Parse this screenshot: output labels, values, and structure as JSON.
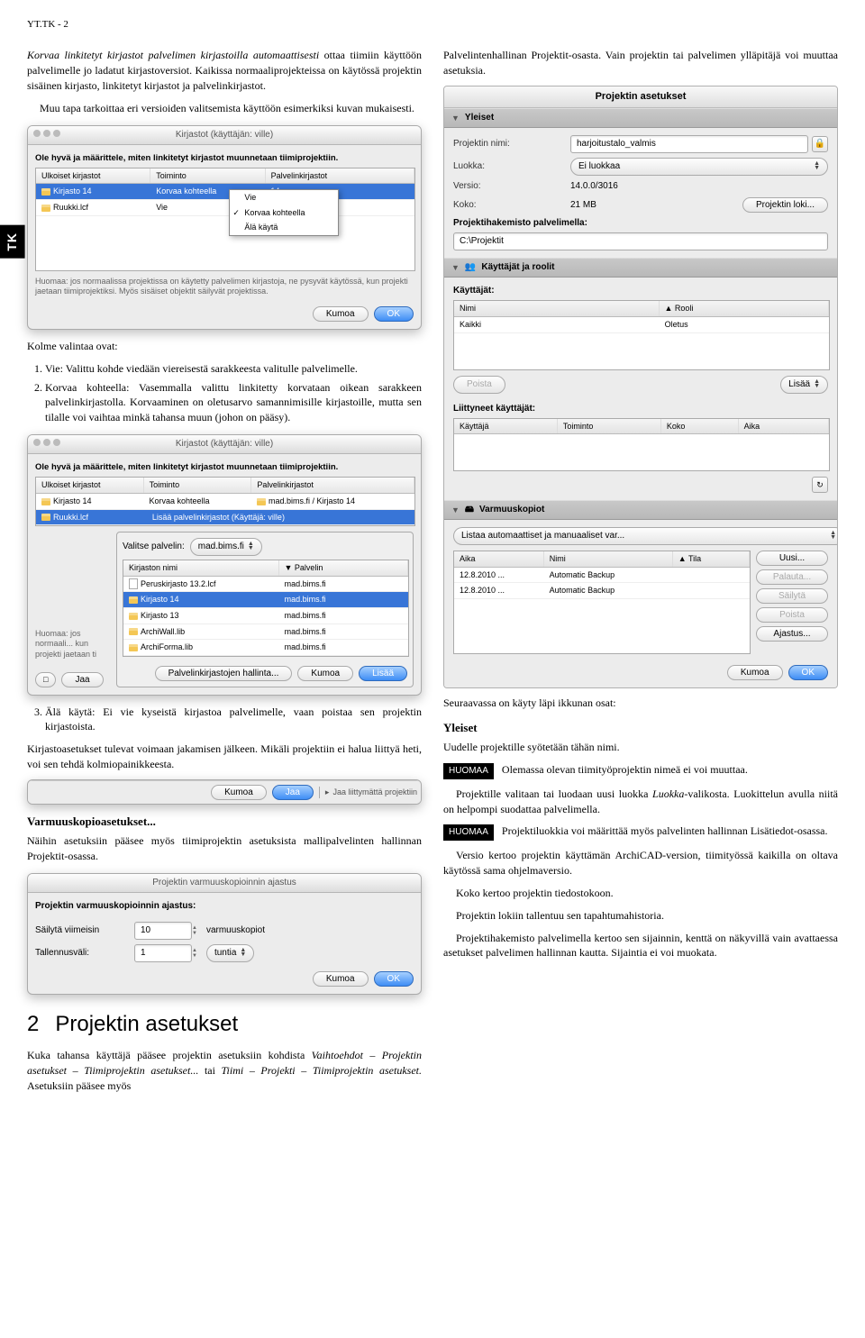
{
  "page_header": "YT.TK - 2",
  "side_tab": "TK",
  "left": {
    "intro_p1_italic": "Korvaa linkitetyt kirjastot palvelimen kirjastoilla automaattisesti",
    "intro_p1_rest": " ottaa tiimiin käyttöön palvelimelle jo ladatut kirjastoversiot. Kaikissa normaaliprojekteissa on käytössä projektin sisäinen kirjasto, linkitetyt kirjastot ja palvelinkirjastot.",
    "intro_p2": "Muu tapa tarkoittaa eri versioiden valitsemista käyttöön esimerkiksi kuvan mukaisesti.",
    "dlg1": {
      "title": "Kirjastot (käyttäjän: ville)",
      "instr": "Ole hyvä ja määrittele, miten linkitetyt kirjastot muunnetaan tiimiprojektiin.",
      "th1": "Ulkoiset kirjastot",
      "th2": "Toiminto",
      "th3": "Palvelinkirjastot",
      "row1_c1": "Kirjasto 14",
      "row1_c2": "Korvaa kohteella",
      "row1_c3": "14",
      "row2_c1": "Ruukki.lcf",
      "row2_c2": "Vie",
      "row2_c3": "cf",
      "dd1": "Vie",
      "dd2": "Korvaa kohteella",
      "dd3": "Älä käytä",
      "note": "Huomaa: jos normaalissa projektissa on käytetty palvelimen kirjastoja, ne pysyvät käytössä, kun projekti jaetaan tiimiprojektiksi. Myös sisäiset objektit säilyvät projektissa.",
      "btn_cancel": "Kumoa",
      "btn_ok": "OK"
    },
    "three_options": "Kolme valintaa ovat:",
    "opt1": "Vie: Valittu kohde viedään viereisestä sarakkeesta valitulle palvelimelle.",
    "opt2": "Korvaa kohteella: Vasemmalla valittu linkitetty korvataan oikean sarakkeen palvelinkirjastolla. Korvaaminen on oletusarvo samannimisille kirjastoille, mutta sen tilalle voi vaihtaa minkä tahansa muun (johon on pääsy).",
    "dlg2": {
      "title": "Kirjastot (käyttäjän: ville)",
      "instr": "Ole hyvä ja määrittele, miten linkitetyt kirjastot muunnetaan tiimiprojektiin.",
      "th1": "Ulkoiset kirjastot",
      "th2": "Toiminto",
      "th3": "Palvelinkirjastot",
      "r1c1": "Kirjasto 14",
      "r1c2": "Korvaa kohteella",
      "r1c3": "mad.bims.fi / Kirjasto 14",
      "r2c1": "Ruukki.lcf",
      "r2c2": "Lisää palvelinkirjastot (Käyttäjä: ville)",
      "select_server": "Valitse palvelin:",
      "server": "mad.bims.fi",
      "sth1": "Kirjaston nimi",
      "sth2": "Palvelin",
      "sr1": "Peruskirjasto 13.2.lcf",
      "sr1s": "mad.bims.fi",
      "sr2": "Kirjasto 14",
      "sr2s": "mad.bims.fi",
      "sr3": "Kirjasto 13",
      "sr3s": "mad.bims.fi",
      "sr4": "ArchiWall.lib",
      "sr4s": "mad.bims.fi",
      "sr5": "ArchiForma.lib",
      "sr5s": "mad.bims.fi",
      "note": "Huomaa: jos normaali... kun projekti jaetaan ti",
      "btn_jaa": "Jaa",
      "btn_manage": "Palvelinkirjastojen hallinta...",
      "btn_cancel": "Kumoa",
      "btn_add": "Lisää"
    },
    "opt3": "Älä käytä: Ei vie kyseistä kirjastoa palvelimelle, vaan poistaa sen projektin kirjastoista.",
    "after_opts": "Kirjastoasetukset tulevat voimaan jakamisen jälkeen. Mikäli projektiin ei halua liittyä heti, voi sen tehdä kolmiopainikkeesta.",
    "joinbar": {
      "cancel": "Kumoa",
      "jaa": "Jaa",
      "joinwo": "Jaa liittymättä projektiin"
    },
    "backup_head": "Varmuuskopioasetukset...",
    "backup_p": "Näihin asetuksiin pääsee myös tiimiprojektin asetuksista mallipalvelinten hallinnan Projektit-osassa.",
    "backup_dlg": {
      "title": "Projektin varmuuskopioinnin ajastus",
      "h": "Projektin varmuuskopioinnin ajastus:",
      "l1": "Säilytä viimeisin",
      "v1": "10",
      "u1": "varmuuskopiot",
      "l2": "Tallennusväli:",
      "v2": "1",
      "u2": "tuntia",
      "cancel": "Kumoa",
      "ok": "OK"
    },
    "sec2_num": "2",
    "sec2_title": "Projektin asetukset",
    "sec2_p1a": "Kuka tahansa käyttäjä pääsee projektin asetuksiin kohdista ",
    "sec2_p1b": "Vaihtoehdot – Projektin asetukset – Tiimiprojektin asetukset...",
    "sec2_p1c": " tai ",
    "sec2_p1d": "Tiimi – Projekti – Tiimiprojektin asetukset.",
    "sec2_p1e": " Asetuksiin pääsee myös"
  },
  "right": {
    "intro": "Palvelintenhallinan Projektit-osasta. Vain projektin tai palvelimen ylläpitäjä voi muuttaa asetuksia.",
    "panel": {
      "title": "Projektin asetukset",
      "g1": "Yleiset",
      "l_name": "Projektin nimi:",
      "v_name": "harjoitustalo_valmis",
      "l_class": "Luokka:",
      "v_class": "Ei luokkaa",
      "l_version": "Versio:",
      "v_version": "14.0.0/3016",
      "l_size": "Koko:",
      "v_size": "21 MB",
      "btn_log": "Projektin loki...",
      "l_dir": "Projektihakemisto palvelimella:",
      "v_dir": "C:\\Projektit",
      "g2": "Käyttäjät ja roolit",
      "l_users": "Käyttäjät:",
      "th_name": "Nimi",
      "th_role": "Rooli",
      "u1": "Kaikki",
      "r1": "Oletus",
      "btn_remove": "Poista",
      "btn_add": "Lisää",
      "l_joined": "Liittyneet käyttäjät:",
      "jth1": "Käyttäjä",
      "jth2": "Toiminto",
      "jth3": "Koko",
      "jth4": "Aika",
      "g3": "Varmuuskopiot",
      "combo": "Listaa automaattiset ja manuaaliset var...",
      "bth1": "Aika",
      "bth2": "Nimi",
      "bth3": "Tila",
      "b1d": "12.8.2010 ...",
      "b1n": "Automatic Backup",
      "b2d": "12.8.2010 ...",
      "b2n": "Automatic Backup",
      "rbtn1": "Uusi...",
      "rbtn2": "Palauta...",
      "rbtn3": "Säilytä",
      "rbtn4": "Poista",
      "rbtn5": "Ajastus...",
      "cancel": "Kumoa",
      "ok": "OK"
    },
    "next_header": "Seuraavassa on käyty läpi ikkunan osat:",
    "sub1": "Yleiset",
    "sub1_p": "Uudelle projektille syötetään tähän nimi.",
    "note1_badge": "HUOMAA",
    "note1": " Olemassa olevan tiimityöprojektin nimeä ei voi muuttaa.",
    "p2a": "Projektille valitaan tai luodaan uusi luokka ",
    "p2b": "Luokka",
    "p2c": "-valikosta. Luokittelun avulla niitä on helpompi suodattaa palvelimella.",
    "note2_badge": "HUOMAA",
    "note2": " Projektiluokkia voi määrittää myös palvelinten hallinnan Lisätiedot-osassa.",
    "p3a": "Versio kertoo projektin käyttämän ArchiCAD-version, tiimityössä kaikilla on oltava käytössä sama ohjelmaversio.",
    "p3b": "Koko kertoo projektin tiedostokoon.",
    "p3c": "Projektin lokiin tallentuu sen tapahtumahistoria.",
    "p3d": "Projektihakemisto palvelimella kertoo sen sijainnin, kenttä on näkyvillä vain avattaessa asetukset palvelimen hallinnan kautta. Sijaintia ei voi muokata."
  }
}
